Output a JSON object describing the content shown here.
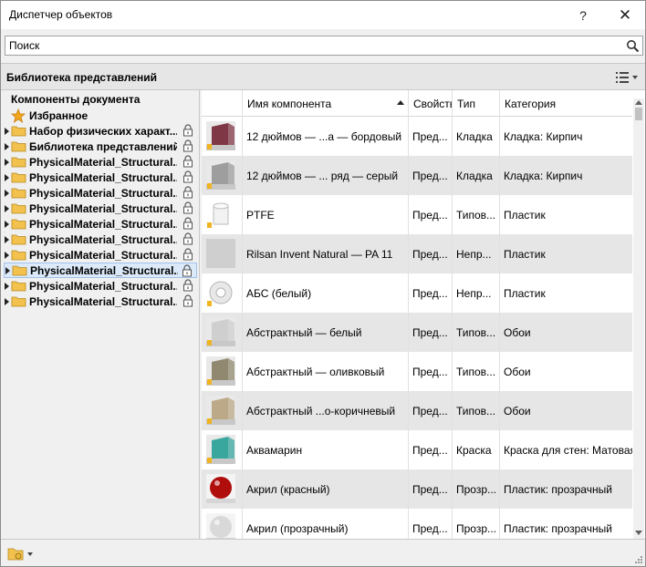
{
  "window": {
    "title": "Диспетчер объектов",
    "help_label": "?",
    "close_label": "✕"
  },
  "search": {
    "placeholder": "Поиск"
  },
  "library": {
    "title": "Библиотека представлений"
  },
  "tree": {
    "root": "Компоненты документа",
    "favorites": "Избранное",
    "items": [
      "Набор физических характ...",
      "Библиотека представлений",
      "PhysicalMaterial_Structural...",
      "PhysicalMaterial_Structural...",
      "PhysicalMaterial_Structural...",
      "PhysicalMaterial_Structural...",
      "PhysicalMaterial_Structural...",
      "PhysicalMaterial_Structural...",
      "PhysicalMaterial_Structural...",
      "PhysicalMaterial_Structural...",
      "PhysicalMaterial_Structural...",
      "PhysicalMaterial_Structural..."
    ],
    "selected_index": 9
  },
  "table": {
    "columns": [
      "",
      "Имя компонента",
      "Свойств",
      "Тип",
      "Категория"
    ],
    "rows": [
      {
        "name": "12 дюймов — ...а — бордовый",
        "props": "Пред...",
        "type": "Кладка",
        "category": "Кладка: Кирпич",
        "thumb": "brick-red"
      },
      {
        "name": "12 дюймов — ... ряд — серый",
        "props": "Пред...",
        "type": "Кладка",
        "category": "Кладка: Кирпич",
        "thumb": "brick-gray"
      },
      {
        "name": "PTFE",
        "props": "Пред...",
        "type": "Типов...",
        "category": "Пластик",
        "thumb": "cylinder-white"
      },
      {
        "name": "Rilsan Invent Natural — PA 11",
        "props": "Пред...",
        "type": "Непр...",
        "category": "Пластик",
        "thumb": "flat-gray"
      },
      {
        "name": "АБС (белый)",
        "props": "Пред...",
        "type": "Непр...",
        "category": "Пластик",
        "thumb": "torus-white"
      },
      {
        "name": "Абстрактный — белый",
        "props": "Пред...",
        "type": "Типов...",
        "category": "Обои",
        "thumb": "wall-white"
      },
      {
        "name": "Абстрактный — оливковый",
        "props": "Пред...",
        "type": "Типов...",
        "category": "Обои",
        "thumb": "wall-olive"
      },
      {
        "name": "Абстрактный ...о-коричневый",
        "props": "Пред...",
        "type": "Типов...",
        "category": "Обои",
        "thumb": "wall-tan"
      },
      {
        "name": "Аквамарин",
        "props": "Пред...",
        "type": "Краска",
        "category": "Краска для стен: Матовая",
        "thumb": "wall-teal"
      },
      {
        "name": "Акрил (красный)",
        "props": "Пред...",
        "type": "Прозр...",
        "category": "Пластик: прозрачный",
        "thumb": "sphere-red"
      },
      {
        "name": "Акрил (прозрачный)",
        "props": "Пред...",
        "type": "Прозр...",
        "category": "Пластик: прозрачный",
        "thumb": "sphere-clear"
      }
    ]
  },
  "colors": {
    "brick-red": "#7a2d3c",
    "brick-gray": "#9a9a9a",
    "cylinder-white": "#f2f2f2",
    "flat-gray": "#cfcfcf",
    "torus-white": "#e8e8e8",
    "wall-white": "#cdcdcd",
    "wall-olive": "#8b8468",
    "wall-tan": "#b8a582",
    "wall-teal": "#2fa39a",
    "sphere-red": "#b00d0d",
    "sphere-clear": "#d9d9d9"
  }
}
